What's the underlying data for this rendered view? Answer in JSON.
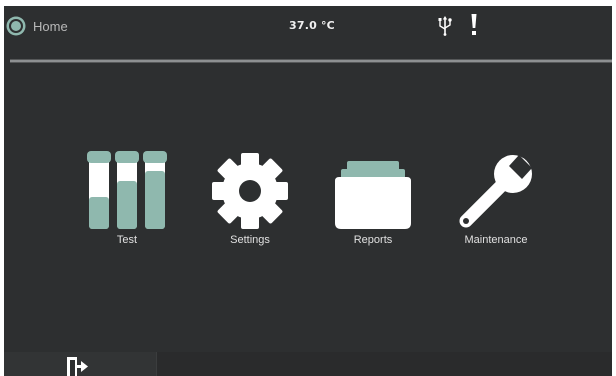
{
  "header": {
    "home_label": "Home",
    "temperature": "37.0 °C",
    "usb_icon": "usb-icon",
    "alert_icon": "exclamation-icon"
  },
  "menu": {
    "items": [
      {
        "label": "Test",
        "icon": "test-tubes-icon"
      },
      {
        "label": "Settings",
        "icon": "gear-icon"
      },
      {
        "label": "Reports",
        "icon": "folder-icon"
      },
      {
        "label": "Maintenance",
        "icon": "wrench-icon"
      }
    ]
  },
  "footer": {
    "logout_icon": "logout-icon"
  },
  "colors": {
    "background": "#2d2f30",
    "accent_teal": "#8fb8ae",
    "icon_white": "#ffffff",
    "label_text": "#e0e0e0"
  }
}
